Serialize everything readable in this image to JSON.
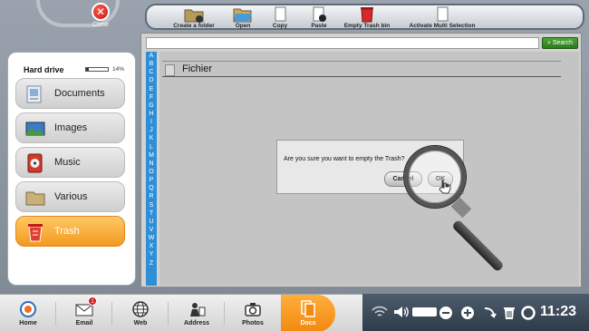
{
  "close": {
    "label": "Close"
  },
  "toolbar": {
    "create_folder": "Create a folder",
    "open": "Open",
    "copy": "Copy",
    "paste": "Paste",
    "empty_trash": "Empty Trash bin",
    "activate_multi": "Activate Multi Selection"
  },
  "sidebar": {
    "hard_drive_label": "Hard drive",
    "usage_percent_label": "14%",
    "usage_fraction": 0.14,
    "items": [
      {
        "label": "Documents"
      },
      {
        "label": "Images"
      },
      {
        "label": "Music"
      },
      {
        "label": "Various"
      },
      {
        "label": "Trash"
      }
    ]
  },
  "search": {
    "button_label": "Search",
    "value": ""
  },
  "alphabet": [
    "A",
    "B",
    "C",
    "D",
    "E",
    "F",
    "G",
    "H",
    "I",
    "J",
    "K",
    "L",
    "M",
    "N",
    "O",
    "P",
    "Q",
    "R",
    "S",
    "T",
    "U",
    "V",
    "W",
    "X",
    "Y",
    "Z"
  ],
  "folder": {
    "title": "Fichier"
  },
  "dialog": {
    "message": "Are you sure you want to empty the Trash?",
    "cancel_label": "Cancel",
    "ok_label": "OK"
  },
  "taskbar": {
    "items": [
      {
        "label": "Home"
      },
      {
        "label": "Email",
        "badge": "1"
      },
      {
        "label": "Web"
      },
      {
        "label": "Address"
      },
      {
        "label": "Photos"
      },
      {
        "label": "Docs"
      }
    ]
  },
  "status": {
    "time": "11:23"
  },
  "colors": {
    "accent_orange": "#f29a20",
    "alpha_blue": "#2e8fd9",
    "search_green": "#2c7a1c"
  }
}
